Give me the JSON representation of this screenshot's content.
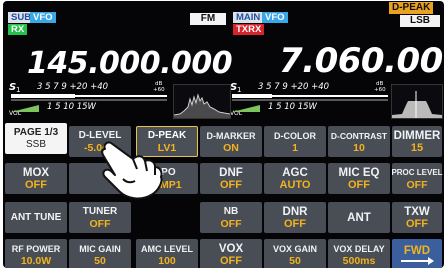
{
  "status_bar": {
    "sub_label": "SUB",
    "sub_vfo": "VFO",
    "rx_label": "RX",
    "main_label": "MAIN",
    "main_vfo": "VFO",
    "txrx_label": "TXRX",
    "mode_sub": "FM",
    "filter_main": "D-PEAK",
    "mode_main": "LSB"
  },
  "sub_band": {
    "frequency": "145.000.000"
  },
  "main_band": {
    "frequency": "7.060.000"
  },
  "meter_labels": {
    "s_scale": "3  5  7  9  +20  +40",
    "po_scale": "1   5   10   15W",
    "s_label": "S1",
    "vol_label": "VOL",
    "db_label": "dB +60"
  },
  "page_button": {
    "line1": "PAGE 1/3",
    "line2": "SSB"
  },
  "buttons": [
    {
      "l1": "D-LEVEL",
      "l2": "-5.0dB"
    },
    {
      "l1": "D-PEAK",
      "l2": "LV1"
    },
    {
      "l1": "D-MARKER",
      "l2": "ON"
    },
    {
      "l1": "D-COLOR",
      "l2": "1"
    },
    {
      "l1": "D-CONTRAST",
      "l2": "10"
    },
    {
      "l1": "DIMMER",
      "l2": "15"
    },
    {
      "l1": "MOX",
      "l2": "OFF"
    },
    {
      "l1": "",
      "l2": ""
    },
    {
      "l1": "IPO",
      "l2": "AMP1"
    },
    {
      "l1": "DNF",
      "l2": "OFF"
    },
    {
      "l1": "AGC",
      "l2": "AUTO"
    },
    {
      "l1": "MIC EQ",
      "l2": "OFF"
    },
    {
      "l1": "PROC LEVEL",
      "l2": "OFF"
    },
    {
      "l1": "ANT TUNE",
      "l2": ""
    },
    {
      "l1": "TUNER",
      "l2": "OFF"
    },
    {
      "l1": "NB",
      "l2": "OFF"
    },
    {
      "l1": "DNR",
      "l2": "OFF"
    },
    {
      "l1": "ANT",
      "l2": ""
    },
    {
      "l1": "TXW",
      "l2": "OFF"
    },
    {
      "l1": "RF POWER",
      "l2": "10.0W"
    },
    {
      "l1": "MIC GAIN",
      "l2": "50"
    },
    {
      "l1": "AMC LEVEL",
      "l2": "100"
    },
    {
      "l1": "VOX",
      "l2": "OFF"
    },
    {
      "l1": "VOX GAIN",
      "l2": "50"
    },
    {
      "l1": "VOX DELAY",
      "l2": "500ms"
    },
    {
      "l1": "FWD",
      "l2": ""
    }
  ],
  "colors": {
    "value_text": "#f2b31e",
    "button_bg": "#484d56",
    "vfo_tag": "#3aa8e6",
    "rx_tag": "#24c24a",
    "txrx_tag": "#d8232a",
    "filter_tag": "#e9a21f"
  },
  "icons": {
    "touch_hand": "pointing-hand-icon"
  }
}
